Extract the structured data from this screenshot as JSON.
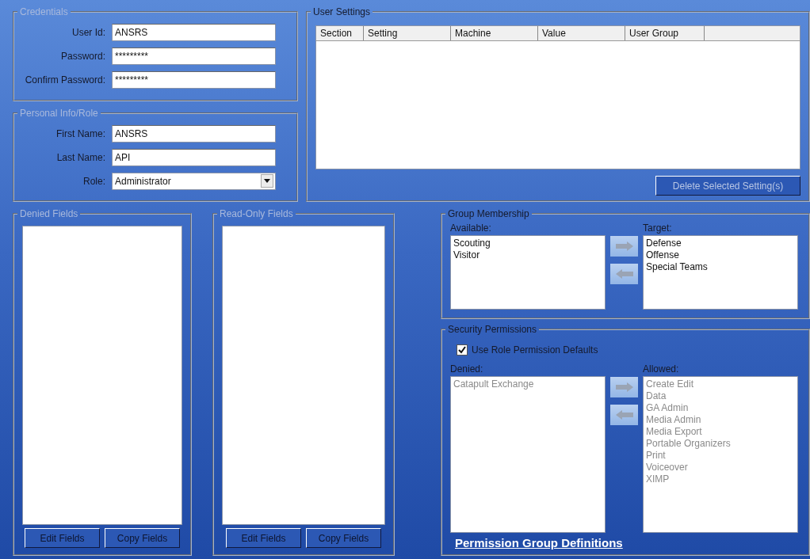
{
  "credentials": {
    "title": "Credentials",
    "disabled": true,
    "fields": [
      {
        "label": "User Id:",
        "value": "ANSRS",
        "kind": "text"
      },
      {
        "label": "Password:",
        "value": "*********",
        "kind": "text"
      },
      {
        "label": "Confirm Password:",
        "value": "*********",
        "kind": "text"
      }
    ]
  },
  "personal_info": {
    "title": "Personal Info/Role",
    "disabled": true,
    "fields": [
      {
        "label": "First Name:",
        "value": "ANSRS",
        "kind": "text"
      },
      {
        "label": "Last Name:",
        "value": "API",
        "kind": "text"
      },
      {
        "label": "Role:",
        "value": "Administrator",
        "kind": "dropdown"
      }
    ]
  },
  "user_settings": {
    "title": "User Settings",
    "disabled": false,
    "columns": [
      "Section",
      "Setting",
      "Machine",
      "Value",
      "User Group"
    ],
    "delete_button": {
      "label": "Delete Selected Setting(s)",
      "disabled": true
    }
  },
  "denied_fields": {
    "title": "Denied Fields",
    "disabled": true,
    "buttons": [
      "Edit Fields",
      "Copy Fields"
    ]
  },
  "read_only_fields": {
    "title": "Read-Only Fields",
    "disabled": true,
    "buttons": [
      "Edit Fields",
      "Copy Fields"
    ]
  },
  "group_membership": {
    "title": "Group Membership",
    "disabled": false,
    "left": {
      "label": "Available:",
      "disabled": false,
      "items": [
        "Scouting",
        "Visitor"
      ]
    },
    "right": {
      "label": "Target:",
      "disabled": false,
      "items": [
        "Defense",
        "Offense",
        "Special Teams"
      ]
    }
  },
  "security_permissions": {
    "title": "Security Permissions",
    "disabled": false,
    "checkbox": {
      "label": "Use Role Permission Defaults",
      "checked": true
    },
    "left": {
      "label": "Denied:",
      "disabled": true,
      "items": [
        "Catapult Exchange"
      ]
    },
    "right": {
      "label": "Allowed:",
      "disabled": true,
      "items": [
        "Create Edit",
        "Data",
        "GA Admin",
        "Media Admin",
        "Media Export",
        "Portable Organizers",
        "Print",
        "Voiceover",
        "XIMP"
      ]
    },
    "link": "Permission Group Definitions"
  }
}
